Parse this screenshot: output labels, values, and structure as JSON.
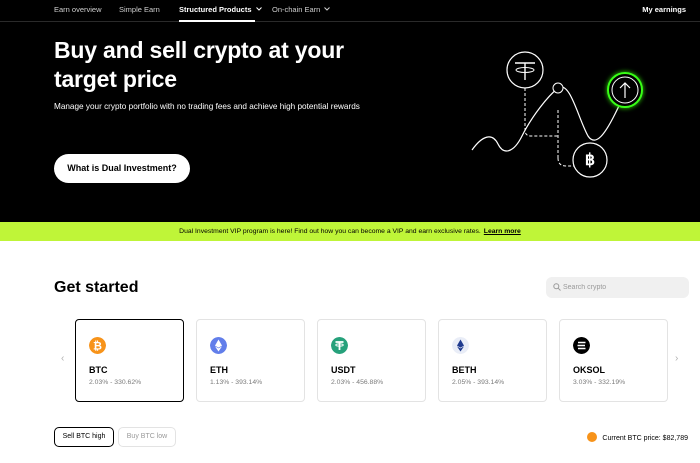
{
  "nav": {
    "items": [
      {
        "label": "Earn overview"
      },
      {
        "label": "Simple Earn"
      },
      {
        "label": "Structured Products"
      },
      {
        "label": "On-chain Earn"
      }
    ],
    "my_earnings": "My earnings"
  },
  "hero": {
    "title": "Buy and sell crypto at your target price",
    "subtitle": "Manage your crypto portfolio with no trading fees and achieve high potential rewards",
    "button": "What is Dual Investment?"
  },
  "banner": {
    "text": "Dual Investment VIP program is here! Find out how you can become a VIP and earn exclusive rates.",
    "link": "Learn more"
  },
  "get_started": {
    "title": "Get started",
    "search_placeholder": "Search crypto"
  },
  "coins": [
    {
      "name": "BTC",
      "range": "2.03% - 330.62%",
      "icon": "bitcoin-icon",
      "color": "#f7931a"
    },
    {
      "name": "ETH",
      "range": "1.13% - 393.14%",
      "icon": "ethereum-icon",
      "color": "#627eea"
    },
    {
      "name": "USDT",
      "range": "2.03% - 456.88%",
      "icon": "tether-icon",
      "color": "#26a17b"
    },
    {
      "name": "BETH",
      "range": "2.05% - 393.14%",
      "icon": "beth-icon",
      "color": "#e9edf7"
    },
    {
      "name": "OKSOL",
      "range": "3.03% - 332.19%",
      "icon": "oksol-icon",
      "color": "#000000"
    }
  ],
  "tabs": {
    "sell": "Sell BTC high",
    "buy": "Buy BTC low"
  },
  "price": {
    "text": "Current BTC price: $82,789"
  },
  "colors": {
    "accent": "#bff538",
    "neon": "#39ff14"
  }
}
